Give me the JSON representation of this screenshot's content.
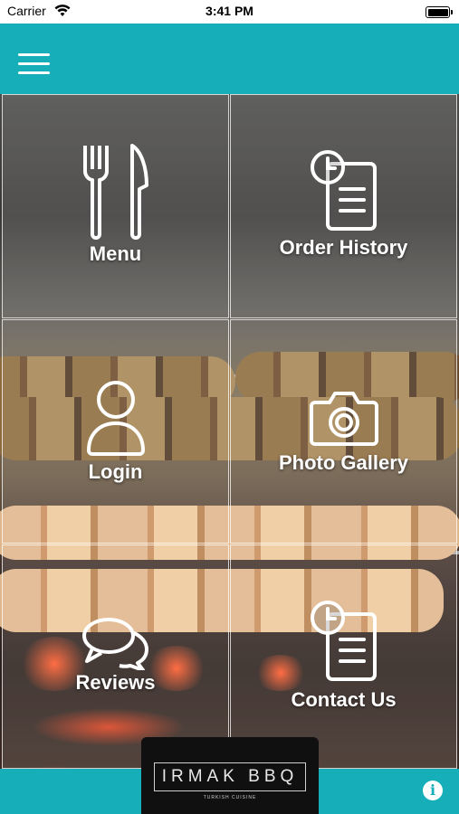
{
  "status_bar": {
    "carrier": "Carrier",
    "time": "3:41 PM"
  },
  "nav": {
    "menu_icon": "hamburger-menu-icon"
  },
  "tiles": [
    {
      "label": "Menu",
      "icon": "fork-knife-icon"
    },
    {
      "label": "Order History",
      "icon": "clock-document-icon"
    },
    {
      "label": "Login",
      "icon": "user-icon"
    },
    {
      "label": "Photo Gallery",
      "icon": "camera-icon"
    },
    {
      "label": "Reviews",
      "icon": "chat-bubbles-icon"
    },
    {
      "label": "Contact Us",
      "icon": "clock-document-icon"
    }
  ],
  "logo": {
    "name": "IRMAK BBQ",
    "tagline": "TURKISH CUISINE"
  },
  "info_button": {
    "glyph": "i",
    "icon": "info-icon"
  },
  "colors": {
    "accent": "#16aeb8",
    "tile_border": "#ffffff",
    "logo_bg": "#101010"
  }
}
